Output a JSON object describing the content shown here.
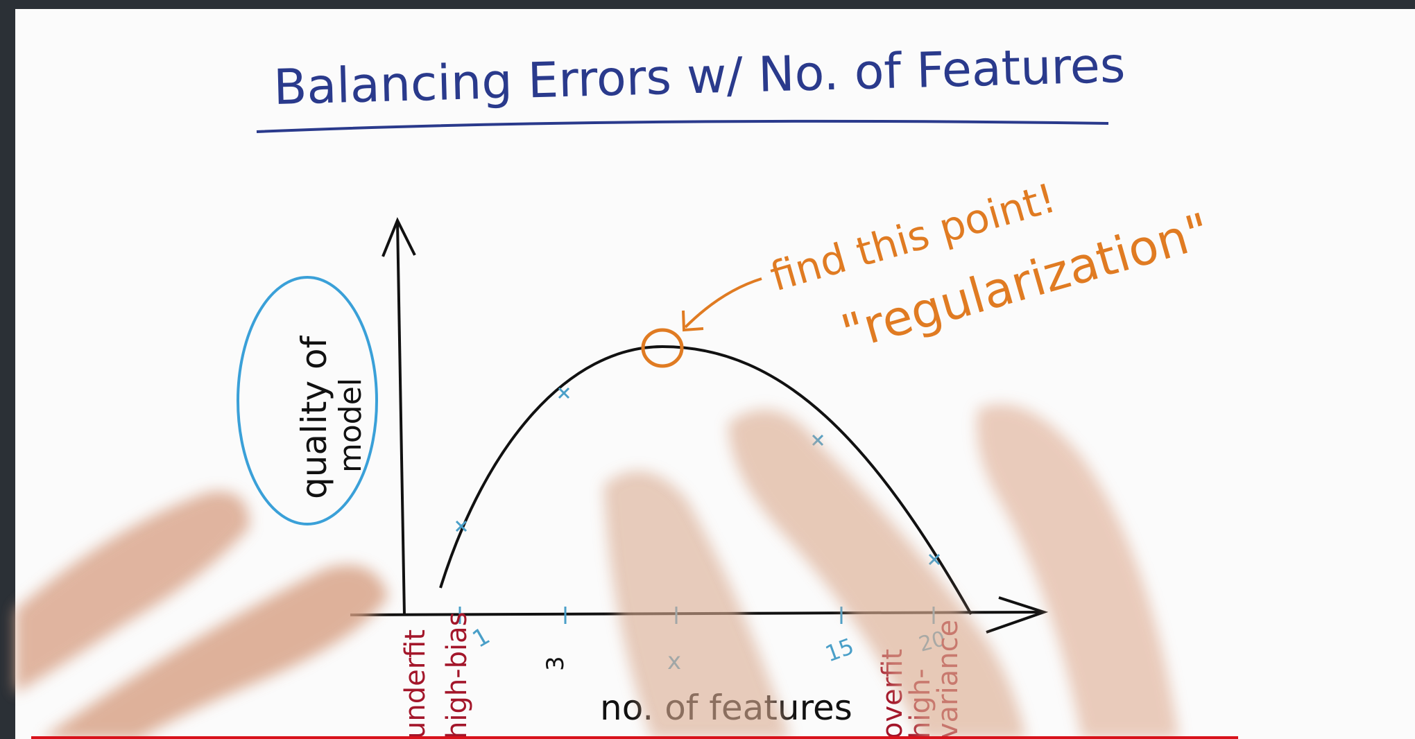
{
  "title": "Balancing Errors w/ No. of Features",
  "annotation_find": "find this point!",
  "annotation_regularization": "\"regularization\"",
  "ylabel_line1": "quality of",
  "ylabel_line2": "model",
  "xlabel": "no. of features",
  "ticks": [
    {
      "x": 1,
      "label": "1"
    },
    {
      "x": 3,
      "label": "3"
    },
    {
      "x": 6,
      "label": "x"
    },
    {
      "x": 15,
      "label": "15"
    },
    {
      "x": 20,
      "label": "20"
    }
  ],
  "underfit_label": [
    "underfit",
    "high-bias"
  ],
  "overfit_label": [
    "overfit",
    "high-",
    "variance"
  ],
  "colors": {
    "title": "#2a3a8c",
    "curve": "#111111",
    "axes": "#111111",
    "highlight": "#e07b22",
    "ylabel_circle": "#3aa0d8",
    "ticks": "#4a9fc8",
    "side_labels": "#a3162a",
    "progress": "#d8121b"
  }
}
